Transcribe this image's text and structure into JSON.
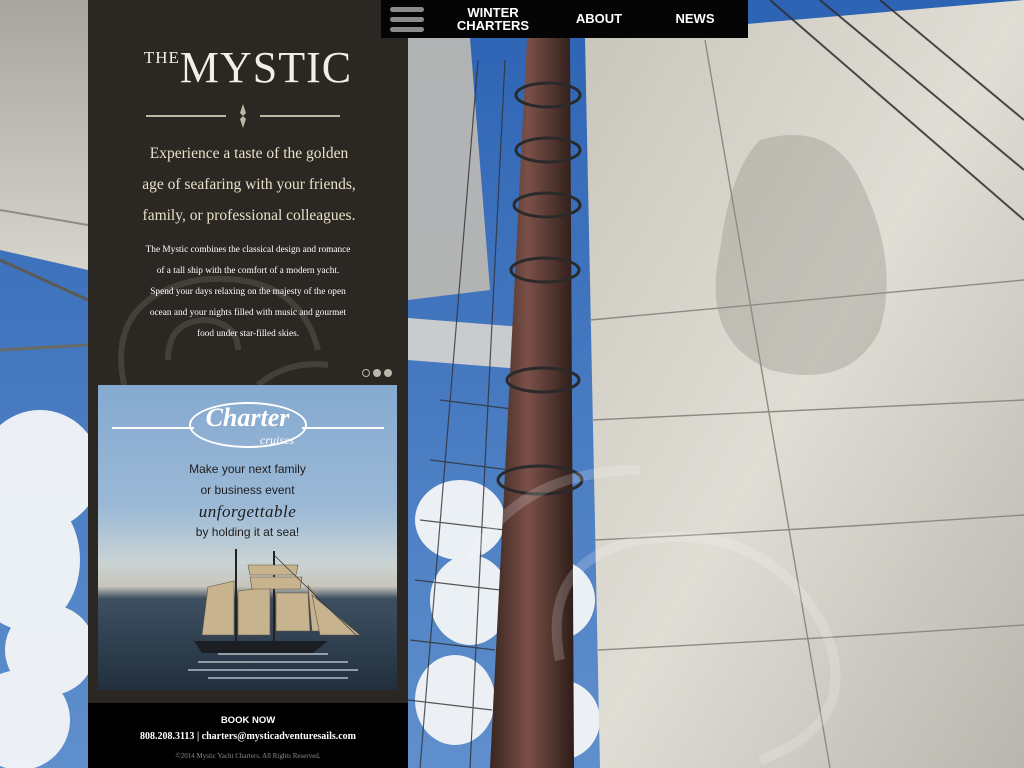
{
  "nav": {
    "winter_line1": "WINTER",
    "winter_line2": "CHARTERS",
    "about": "ABOUT",
    "news": "NEWS"
  },
  "brand": {
    "the": "THE",
    "name": "MYSTIC"
  },
  "intro": {
    "tagline_lines": [
      "Experience a taste of the golden",
      "age of seafaring with your friends,",
      "family, or professional colleagues."
    ],
    "description_lines": [
      "The Mystic combines the classical design and romance",
      "of a tall ship with the comfort of a modern yacht.",
      "Spend your days relaxing on the majesty of the open",
      "ocean and your nights filled with music and gourmet",
      "food under star-filled skies."
    ]
  },
  "carousel": {
    "count": 3,
    "active_index": 0
  },
  "charter_ad": {
    "logo_word1": "Charter",
    "logo_word2": "cruises",
    "line1": "Make your next family",
    "line2": "or business event",
    "emphasis": "unforgettable",
    "line3": "by holding it at sea!"
  },
  "footer": {
    "book_now": "BOOK NOW",
    "phone": "808.208.3113",
    "separator": "|",
    "email": "charters@mysticadventuresails.com",
    "copyright": "©2014 Mystic Yacht Charters. All Rights Reserved."
  },
  "icons": {
    "menu": "hamburger-menu-icon",
    "divider": "ornament-divider-icon"
  },
  "colors": {
    "panel_bg": "#2b2723",
    "nav_bg": "#050505",
    "sky": "#4f7fc0",
    "sail": "#d9d6ce",
    "mast": "#5a3a32"
  }
}
